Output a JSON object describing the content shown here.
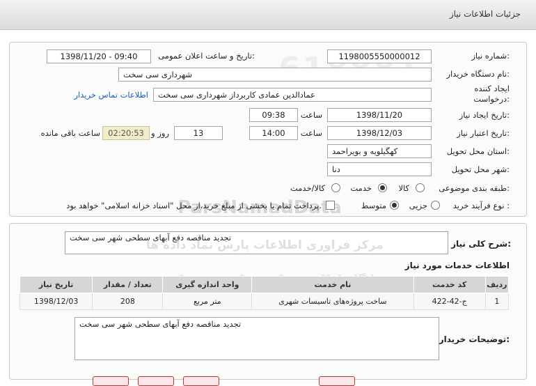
{
  "header": {
    "title": "جزئیات اطلاعات نیاز"
  },
  "labels": {
    "need_number": "شماره نیاز:",
    "announce_datetime": "تاریخ و ساعت اعلان عمومی:",
    "buyer_org": "نام دستگاه خریدار:",
    "creator": "ایجاد کننده درخواست:",
    "contact_link": "اطلاعات تماس خریدار",
    "need_date": "تاریخ ایجاد نیاز:",
    "hour": "ساعت",
    "validity_date": "تاریخ اعتبار نیاز:",
    "day_and": "روز و",
    "hours_remaining": "ساعت باقی مانده",
    "province": "استان محل تحویل:",
    "city": "شهر محل تحویل:",
    "category": "طبقه بندی موضوعی:",
    "process_type": "نوع فرآیند خرید :",
    "general_desc": "شرح کلی نیاز:",
    "services_title": "اطلاعات خدمات مورد نیاز",
    "buyer_notes": "توضیحات خریدار:"
  },
  "values": {
    "need_number": "1198005550000012",
    "announce_datetime": "1398/11/20 - 09:40",
    "buyer_org": "شهرداری سی سخت",
    "creator": "عمادالدین عمادی کاربرداز شهرداری سی سخت",
    "need_date": "1398/11/20",
    "need_time": "09:38",
    "validity_date": "1398/12/03",
    "validity_time": "14:00",
    "days_remaining": "13",
    "time_remaining": "02:20:53",
    "province": "کهگیلویه و بویراحمد",
    "city": "دنا",
    "general_desc": "تجدید مناقصه دفع آبهای سطحی شهر سی سخت",
    "buyer_notes": "تجدید مناقصه دفع آبهای سطحی شهر سی سخت"
  },
  "category_options": [
    {
      "label": "کالا",
      "selected": false
    },
    {
      "label": "خدمت",
      "selected": true
    },
    {
      "label": "کالا/خدمت",
      "selected": false
    }
  ],
  "process_options": [
    {
      "label": "جزیی",
      "selected": false
    },
    {
      "label": "متوسط",
      "selected": true
    }
  ],
  "payment_note": "پرداخت تمام یا بخشی از مبلغ خرید،از محل \"اسناد خزانه اسلامی\" خواهد بود.",
  "payment_checked": false,
  "services_table": {
    "headers": [
      "ردیف",
      "کد خدمت",
      "نام خدمت",
      "واحد اندازه گیری",
      "تعداد / مقدار",
      "تاریخ نیاز"
    ],
    "rows": [
      [
        "1",
        "ج-42-422",
        "ساخت پروژه‌های تاسیسات شهری",
        "متر مربع",
        "208",
        "1398/12/03"
      ]
    ]
  },
  "watermark": {
    "site": "ParsNamadData",
    "site_fa": "مرکز فراوری اطلاعات پارس نماد داده ها",
    "line1": "پایگاه اطلاع رسانی مناقصه ومزایده",
    "phone": "۰۲۱-۸۸۳۴۹۶۷۰-۵"
  },
  "colors": {
    "link": "#1a5fb4",
    "remain_bg": "#f2edc9",
    "table_header_bg": "#d6d6d6",
    "watermark": "#c9c9c9"
  }
}
